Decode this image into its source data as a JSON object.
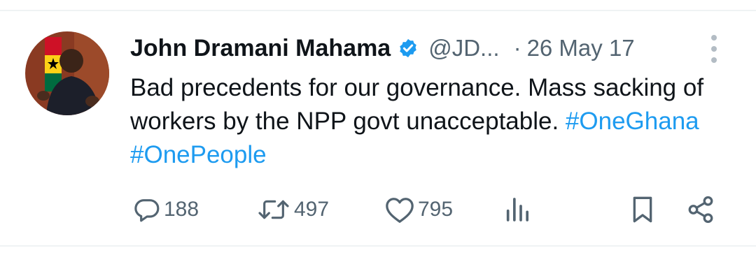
{
  "tweet": {
    "author_name": "John Dramani Mahama",
    "handle": "@JD...",
    "separator": "·",
    "date": "26 May 17",
    "text_plain": "Bad precedents for our governance. Mass sacking of workers by the NPP govt unacceptable. ",
    "hashtags": [
      "#OneGhana",
      "#OnePeople"
    ]
  },
  "actions": {
    "replies": "188",
    "retweets": "497",
    "likes": "795"
  },
  "icons": {
    "verified": "verified-badge-icon",
    "more": "more-options-icon",
    "reply": "reply-icon",
    "retweet": "retweet-icon",
    "like": "heart-icon",
    "views": "analytics-icon",
    "bookmark": "bookmark-icon",
    "share": "share-icon"
  },
  "colors": {
    "accent": "#1d9bf0",
    "muted": "#536471",
    "text": "#0f1419"
  }
}
